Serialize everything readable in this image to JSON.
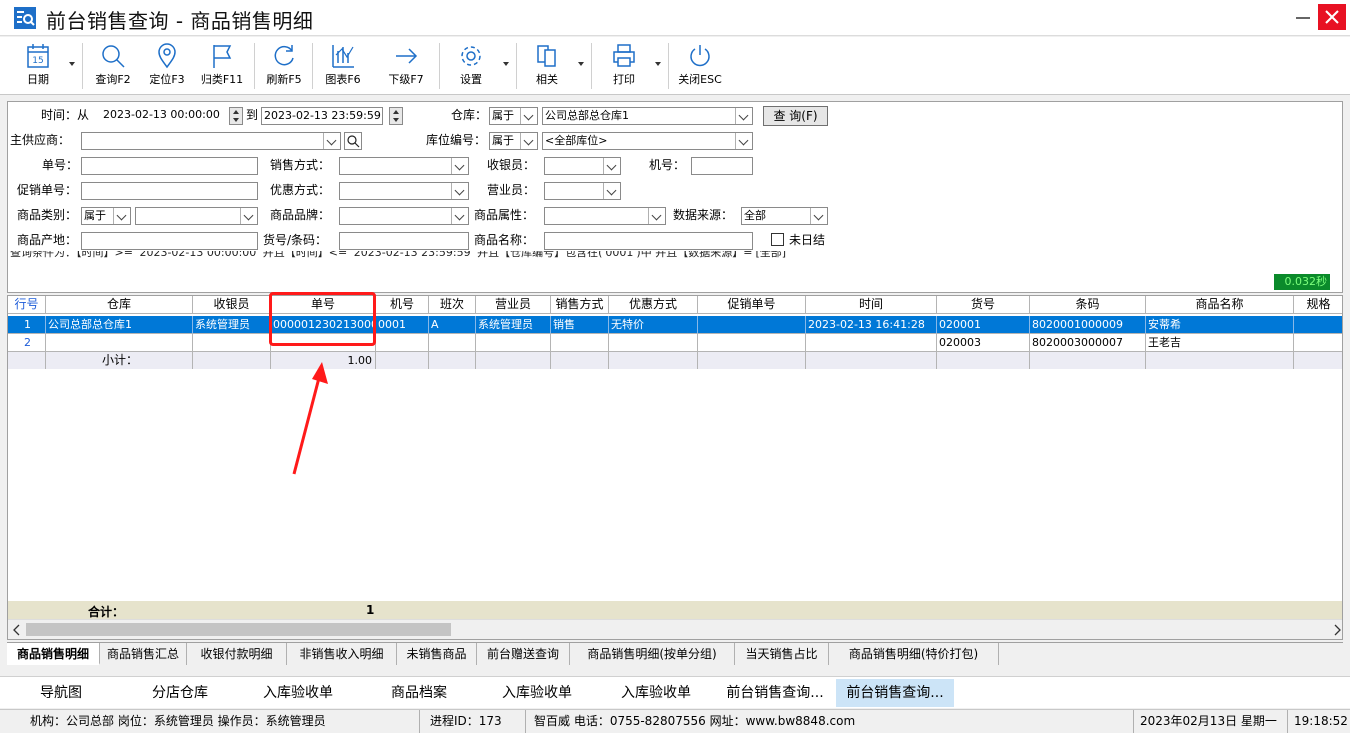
{
  "window": {
    "title": "前台销售查询 - 商品销售明细"
  },
  "toolbar": {
    "items": [
      {
        "label": "日期",
        "icon": "calendar-icon",
        "badge": "15"
      },
      {
        "label": "查询F2",
        "icon": "search-icon"
      },
      {
        "label": "定位F3",
        "icon": "location-pin-icon"
      },
      {
        "label": "归类F11",
        "icon": "flag-icon"
      },
      {
        "label": "刷新F5",
        "icon": "refresh-icon"
      },
      {
        "label": "图表F6",
        "icon": "chart-icon"
      },
      {
        "label": "下级F7",
        "icon": "arrow-right-icon"
      },
      {
        "label": "设置",
        "icon": "gear-icon"
      },
      {
        "label": "相关",
        "icon": "related-docs-icon"
      },
      {
        "label": "打印",
        "icon": "printer-icon"
      },
      {
        "label": "关闭ESC",
        "icon": "power-icon"
      }
    ]
  },
  "filter": {
    "time_label": "时间：从",
    "time_from": "2023-02-13 00:00:00",
    "time_to_label": "到",
    "time_to": "2023-02-13 23:59:59",
    "warehouse_label": "仓库：",
    "warehouse_op": "属于",
    "warehouse_value": "公司总部总仓库1",
    "query_button": "查 询(F)",
    "supplier_label": "主供应商：",
    "supplier_value": "",
    "location_label": "库位编号：",
    "location_op": "属于",
    "location_value": "<全部库位>",
    "order_no_label": "单号：",
    "sales_method_label": "销售方式：",
    "cashier_label": "收银员：",
    "machine_label": "机号：",
    "promo_no_label": "促销单号：",
    "discount_label": "优惠方式：",
    "clerk_label": "营业员：",
    "category_label": "商品类别：",
    "category_op": "属于",
    "brand_label": "商品品牌：",
    "attribute_label": "商品属性：",
    "source_label": "数据来源：",
    "source_value": "全部",
    "origin_label": "商品产地：",
    "code_label": "货号/条码：",
    "name_label": "商品名称：",
    "unsettled_label": "未日结",
    "condition_text": "查询条件为：【时间】>= '2023-02-13 00:00:00' 并且【时间】<= '2023-02-13 23:59:59' 并且【仓库编号】包含在('0001')中 并且【数据来源】='[全部]'",
    "timer": "0.032秒"
  },
  "grid": {
    "columns": [
      "行号",
      "仓库",
      "收银员",
      "单号",
      "机号",
      "班次",
      "营业员",
      "销售方式",
      "优惠方式",
      "促销单号",
      "时间",
      "货号",
      "条码",
      "商品名称",
      "规格"
    ],
    "rows": [
      [
        "1",
        "公司总部总仓库1",
        "系统管理员",
        "0000012302130001",
        "0001",
        "A",
        "系统管理员",
        "销售",
        "无特价",
        "",
        "2023-02-13 16:41:28",
        "020001",
        "8020001000009",
        "安蒂希",
        ""
      ],
      [
        "2",
        "",
        "",
        "",
        "",
        "",
        "",
        "",
        "",
        "",
        "",
        "020003",
        "8020003000007",
        "王老吉",
        ""
      ]
    ],
    "subtotal_label": "小计：",
    "subtotal_value": "1.00",
    "total_label": "合计：",
    "total_value": "1"
  },
  "tabs": [
    "商品销售明细",
    "商品销售汇总",
    "收银付款明细",
    "非销售收入明细",
    "未销售商品",
    "前台赠送查询",
    "商品销售明细(按单分组)",
    "当天销售占比",
    "商品销售明细(特价打包)"
  ],
  "taskbar": [
    "导航图",
    "分店仓库",
    "入库验收单",
    "商品档案",
    "入库验收单",
    "入库验收单",
    "前台销售查询...",
    "前台销售查询..."
  ],
  "status": {
    "org": "机构：公司总部 岗位：系统管理员 操作员：系统管理员",
    "process": "进程ID：173",
    "company": "智百威 电话：0755-82807556 网址：www.bw8848.com",
    "date": "2023年02月13日 星期一",
    "time": "19:18:52"
  },
  "colors": {
    "selection": "#0078d7",
    "annotation": "#ff1a1a",
    "timer_bg": "#0b8a2b",
    "close_button": "#e81123"
  }
}
